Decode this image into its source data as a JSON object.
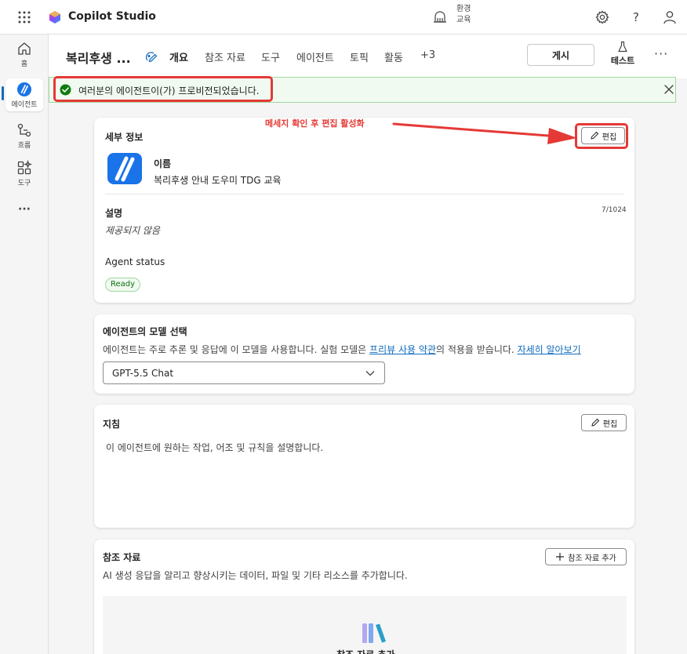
{
  "topbar": {
    "app_title": "Copilot Studio",
    "env_label": "환경",
    "env_name": "교육"
  },
  "leftnav": {
    "items": [
      {
        "label": "홈",
        "icon": "home-icon"
      },
      {
        "label": "에이전트",
        "icon": "agent-icon"
      },
      {
        "label": "흐름",
        "icon": "flow-icon"
      },
      {
        "label": "도구",
        "icon": "tools-icon"
      }
    ],
    "more": "···"
  },
  "header": {
    "agent_name": "복리후생 ...",
    "tabs": [
      "개요",
      "참조 자료",
      "도구",
      "에이전트",
      "토픽",
      "활동",
      "+3"
    ],
    "active_tab": "개요",
    "publish_label": "게시",
    "test_label": "테스트",
    "more": "···"
  },
  "banner": {
    "message": "여러분의 에이전트이(가) 프로비전되었습니다."
  },
  "annotation": {
    "text": "메세지 확인 후 편집 활성화"
  },
  "details": {
    "title": "세부 정보",
    "edit_label": "편집",
    "name_label": "이름",
    "name_value": "복리후생 안내 도우미 TDG 교육",
    "description_label": "설명",
    "description_count": "7/1024",
    "description_value": "제공되지 않음",
    "status_label": "Agent status",
    "status_value": "Ready"
  },
  "model": {
    "title": "에이전트의 모델 선택",
    "desc_prefix": "에이전트는 주로 추론 및 응답에 이 모델을 사용합니다. 실험 모델은 ",
    "desc_link1": "프리뷰 사용 약관",
    "desc_middle": "의 적용을 받습니다. ",
    "desc_link2": "자세히 알아보기",
    "selected": "GPT-5.5 Chat"
  },
  "instructions": {
    "title": "지침",
    "edit_label": "편집",
    "placeholder": "이 에이전트에 원하는 작업, 어조 및 규칙을 설명합니다."
  },
  "knowledge": {
    "title": "참조 자료",
    "add_label": "참조 자료 추가",
    "description": "AI 생성 응답을 알리고 향상시키는 데이터, 파일 및 기타 리소스를 추가합니다.",
    "empty_label": "참조 자료 추가"
  },
  "colors": {
    "accent": "#0f6cbd",
    "success": "#107c10",
    "annotation": "#e53935"
  }
}
